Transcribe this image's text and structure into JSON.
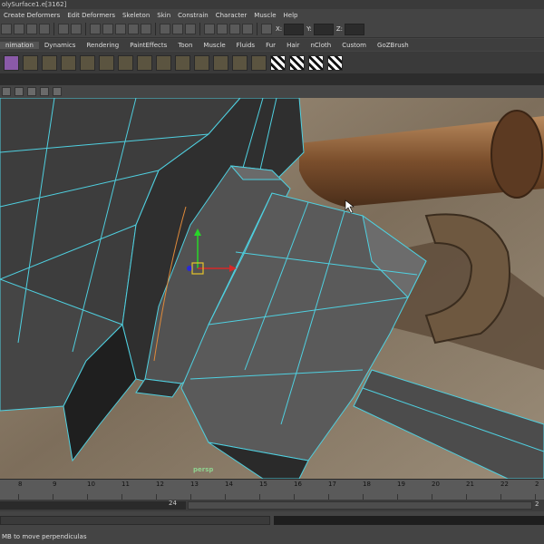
{
  "window": {
    "title": "olySurface1.e[3162]"
  },
  "menubar": [
    "Create Deformers",
    "Edit Deformers",
    "Skeleton",
    "Skin",
    "Constrain",
    "Character",
    "Muscle",
    "Help"
  ],
  "statusline": {
    "x_label": "X:",
    "y_label": "Y:",
    "z_label": "Z:"
  },
  "shelf": {
    "tabs": [
      "nimation",
      "Dynamics",
      "Rendering",
      "PaintEffects",
      "Toon",
      "Muscle",
      "Fluids",
      "Fur",
      "Hair",
      "nCloth",
      "Custom",
      "GoZBrush"
    ],
    "active_tab": "nimation",
    "icons": [
      "poly-cube-icon",
      "bevel-icon",
      "extrude-icon",
      "bridge-icon",
      "append-icon",
      "split-icon",
      "merge-icon",
      "wedge-icon",
      "poke-icon",
      "smooth-icon",
      "triangulate-icon",
      "quadrangulate-icon",
      "mirror-icon",
      "uv-layout-icon",
      "uv-planar-icon",
      "uv-checker-icon",
      "checker-map-icon",
      "checker-flip-icon"
    ]
  },
  "viewport": {
    "camera_label": "persp"
  },
  "timeline": {
    "ticks": [
      "8",
      "9",
      "10",
      "11",
      "12",
      "13",
      "14",
      "15",
      "16",
      "17",
      "18",
      "19",
      "20",
      "21",
      "22",
      "2"
    ]
  },
  "range": {
    "end_value": "24",
    "right_value": "2"
  },
  "helpline": {
    "text": "MB to move perpendiculas"
  },
  "colors": {
    "wire": "#4fd0e0",
    "mesh": "#4a4a4a",
    "background": "#7b7164"
  }
}
